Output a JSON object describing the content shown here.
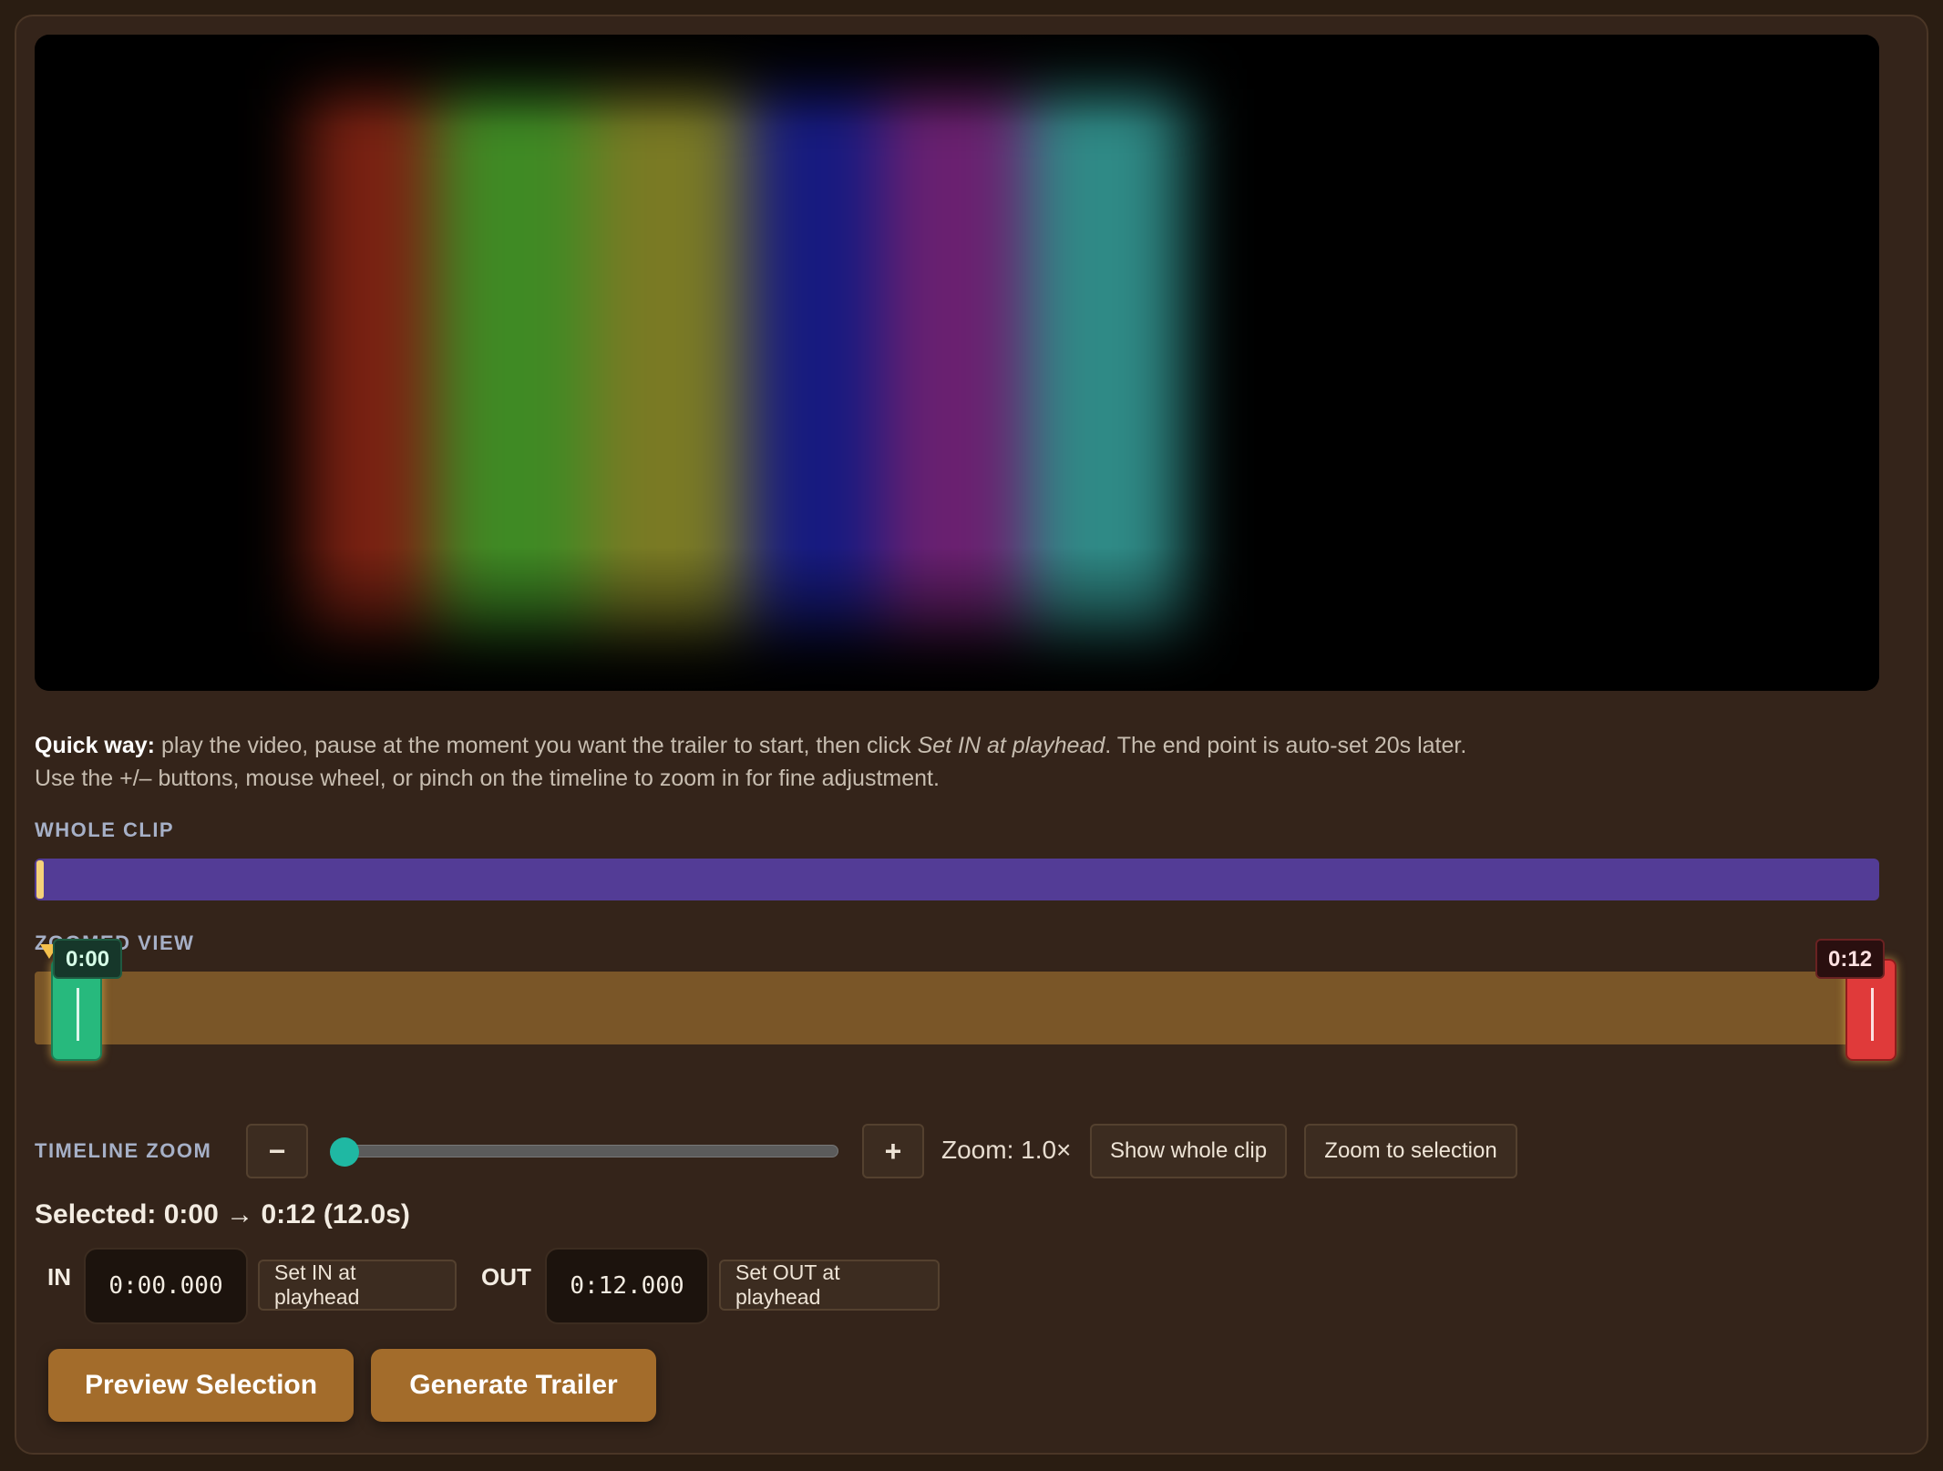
{
  "hint": {
    "quick_label": "Quick way:",
    "line1_before": " play the video, pause at the moment you want the trailer to start, then click ",
    "line1_italic": "Set IN at playhead",
    "line1_after": ". The end point is auto-set 20s later.",
    "line2": "Use the +/– buttons, mouse wheel, or pinch on the timeline to zoom in for fine adjustment."
  },
  "whole_clip": {
    "label": "WHOLE CLIP",
    "selection_fraction_start": 0.0,
    "selection_fraction_end": 0.004
  },
  "zoomed_view": {
    "label": "ZOOMED VIEW",
    "in_tip": "0:00",
    "out_tip": "0:12"
  },
  "timeline_zoom": {
    "label": "TIMELINE ZOOM",
    "minus": "−",
    "plus": "+",
    "slider_value": 0.0,
    "zoom_text": "Zoom: 1.0×",
    "show_whole": "Show whole clip",
    "zoom_to_selection": "Zoom to selection"
  },
  "selection": {
    "summary": "Selected: 0:00 → 0:12 (12.0s)",
    "in_label": "IN",
    "in_value": "0:00.000",
    "set_in": "Set IN at playhead",
    "out_label": "OUT",
    "out_value": "0:12.000",
    "set_out": "Set OUT at playhead"
  },
  "actions": {
    "preview": "Preview Selection",
    "generate": "Generate Trailer"
  },
  "colors": {
    "accent": "#a36c2b",
    "in_handle": "#27b97d",
    "out_handle": "#e03a3a",
    "whole_bar": "#533c96",
    "slider_thumb": "#1fb8a3"
  }
}
